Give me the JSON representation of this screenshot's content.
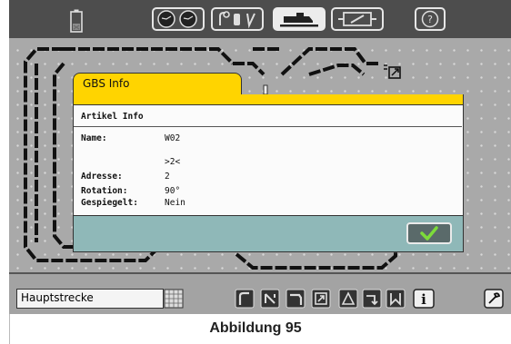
{
  "toolbar": {
    "icons": [
      "battery-icon",
      "speedometers-icon",
      "keys-icon",
      "locomotive-icon",
      "switch-icon",
      "help-icon"
    ]
  },
  "dialog": {
    "title": "GBS Info",
    "section": "Artikel Info",
    "fields": [
      {
        "label": "Name:",
        "value": "W02"
      },
      {
        "label": "",
        "value": ">2<"
      },
      {
        "label": "Adresse:",
        "value": "2"
      },
      {
        "label": "Rotation:",
        "value": "90°"
      },
      {
        "label": "Gespiegelt:",
        "value": "Nein"
      }
    ],
    "ok_icon": "checkmark-icon"
  },
  "bottombar": {
    "section_name": "Hauptstrecke"
  },
  "caption": "Abbildung 95",
  "colors": {
    "toolbar_bg": "#4d4d4d",
    "dialog_accent": "#ffd400",
    "dialog_footer": "#8fb8b8",
    "ok_check": "#7ddc3a"
  }
}
